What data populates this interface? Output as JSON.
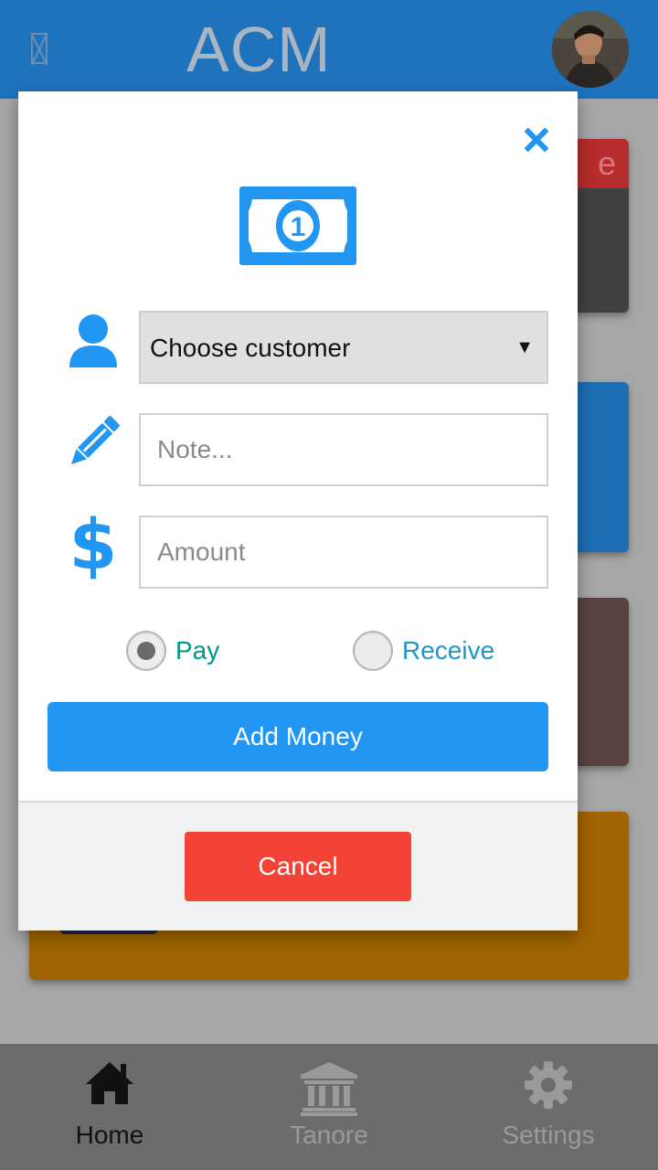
{
  "appbar": {
    "title": "ACM",
    "menu_icon": "broken-image-icon",
    "avatar": "user-avatar"
  },
  "modal": {
    "close_icon": "close-icon",
    "header_icon": "money-bill-icon",
    "header_icon_text": "1",
    "customer_select": {
      "icon": "user-icon",
      "value": "Choose customer",
      "arrow": "▼"
    },
    "note": {
      "icon": "pencil-icon",
      "placeholder": "Note..."
    },
    "amount": {
      "icon": "dollar-icon",
      "icon_glyph": "$",
      "placeholder": "Amount"
    },
    "type_options": [
      {
        "label": "Pay",
        "checked": true,
        "color": "#009688"
      },
      {
        "label": "Receive",
        "checked": false,
        "color": "#2196c9"
      }
    ],
    "submit_label": "Add Money",
    "cancel_label": "Cancel"
  },
  "background_cards": {
    "card1_label_fragment": "e"
  },
  "bottom_nav": {
    "items": [
      {
        "label": "Home",
        "icon": "home-icon",
        "active": true
      },
      {
        "label": "Tanore",
        "icon": "bank-icon",
        "active": false
      },
      {
        "label": "Settings",
        "icon": "gear-icon",
        "active": false
      }
    ]
  },
  "colors": {
    "primary": "#2196f3",
    "appbar": "#1f73bd",
    "danger": "#f44336",
    "pay": "#009688",
    "receive": "#2196c9"
  }
}
